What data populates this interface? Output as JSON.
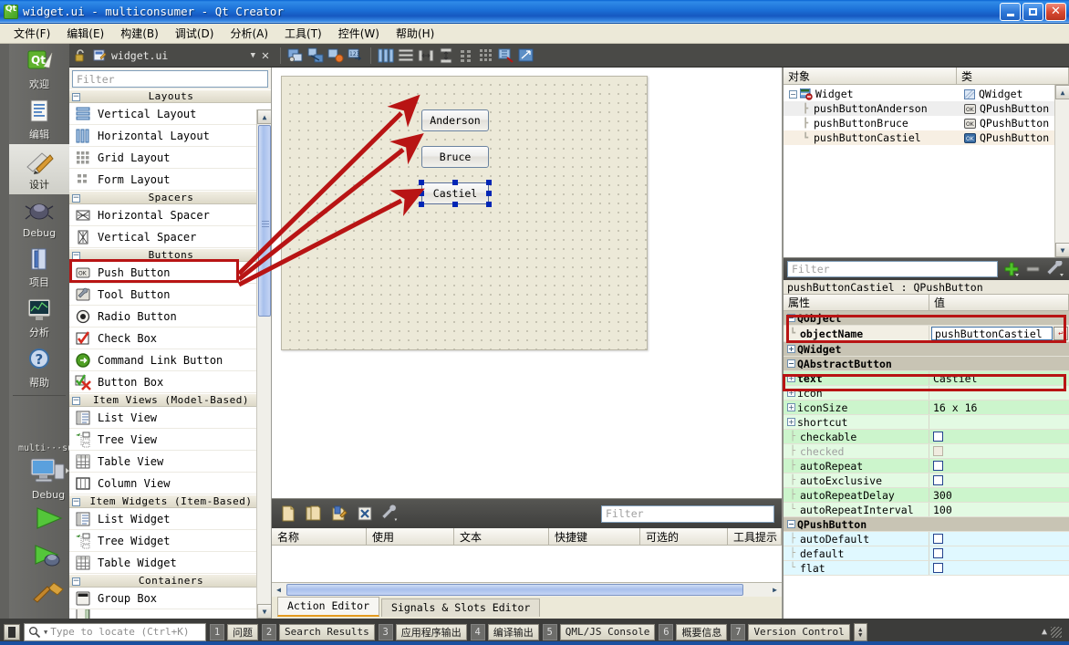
{
  "window": {
    "title": "widget.ui - multiconsumer - Qt Creator",
    "icon": "qt-logo-icon",
    "minimize": "minimize-button",
    "maximize": "maximize-button",
    "close": "close-button"
  },
  "menubar": {
    "items": [
      {
        "label": "文件(F)"
      },
      {
        "label": "编辑(E)"
      },
      {
        "label": "构建(B)"
      },
      {
        "label": "调试(D)"
      },
      {
        "label": "分析(A)"
      },
      {
        "label": "工具(T)"
      },
      {
        "label": "控件(W)"
      },
      {
        "label": "帮助(H)"
      }
    ]
  },
  "modebar": {
    "modes": [
      {
        "label": "欢迎",
        "icon": "qt-welcome-icon",
        "selected": false
      },
      {
        "label": "编辑",
        "icon": "edit-document-icon",
        "selected": false
      },
      {
        "label": "设计",
        "icon": "design-pencil-icon",
        "selected": true
      },
      {
        "label": "Debug",
        "icon": "bug-icon",
        "selected": false
      },
      {
        "label": "项目",
        "icon": "folder-projects-icon",
        "selected": false
      },
      {
        "label": "分析",
        "icon": "analyze-monitor-icon",
        "selected": false
      },
      {
        "label": "帮助",
        "icon": "help-question-icon",
        "selected": false
      }
    ],
    "project_name": "multi···sumer",
    "kit_label": "Debug",
    "kit_icon": "target-computer-icon",
    "run_buttons": [
      {
        "name": "run-button",
        "icon": "play-green-icon"
      },
      {
        "name": "debug-button",
        "icon": "play-debug-icon"
      },
      {
        "name": "build-button",
        "icon": "hammer-icon"
      }
    ]
  },
  "editor_toolbar": {
    "lock_icon": "unlock-icon",
    "file_icon": "ui-file-icon",
    "filename": "widget.ui",
    "dropdown_icon": "chevron-down-icon",
    "close_icon": "close-icon",
    "tools": [
      {
        "name": "edit-widgets-tool",
        "icon": "edit-widgets-icon"
      },
      {
        "name": "edit-signals-slots-tool",
        "icon": "signals-slots-icon"
      },
      {
        "name": "edit-buddies-tool",
        "icon": "buddies-icon"
      },
      {
        "name": "edit-tab-order-tool",
        "icon": "tab-order-icon"
      },
      {
        "name": "layout-horizontally-tool",
        "icon": "layout-horizontal-icon"
      },
      {
        "name": "layout-vertically-tool",
        "icon": "layout-vertical-icon"
      },
      {
        "name": "layout-splitter-horizontal-tool",
        "icon": "splitter-horizontal-icon"
      },
      {
        "name": "layout-splitter-vertical-tool",
        "icon": "splitter-vertical-icon"
      },
      {
        "name": "layout-form-tool",
        "icon": "layout-form-icon"
      },
      {
        "name": "layout-grid-tool",
        "icon": "layout-grid-icon"
      },
      {
        "name": "break-layout-tool",
        "icon": "break-layout-icon"
      },
      {
        "name": "adjust-size-tool",
        "icon": "adjust-size-icon"
      }
    ]
  },
  "widget_box": {
    "filter_placeholder": "Filter",
    "groups": [
      {
        "label": "Layouts",
        "expanded": true,
        "items": [
          {
            "label": "Vertical Layout",
            "icon": "vertical-layout-icon"
          },
          {
            "label": "Horizontal Layout",
            "icon": "horizontal-layout-icon"
          },
          {
            "label": "Grid Layout",
            "icon": "grid-layout-icon"
          },
          {
            "label": "Form Layout",
            "icon": "form-layout-icon"
          }
        ]
      },
      {
        "label": "Spacers",
        "expanded": true,
        "items": [
          {
            "label": "Horizontal Spacer",
            "icon": "horizontal-spacer-icon"
          },
          {
            "label": "Vertical Spacer",
            "icon": "vertical-spacer-icon"
          }
        ]
      },
      {
        "label": "Buttons",
        "expanded": true,
        "items": [
          {
            "label": "Push Button",
            "icon": "push-button-icon",
            "highlighted": true
          },
          {
            "label": "Tool Button",
            "icon": "tool-button-icon"
          },
          {
            "label": "Radio Button",
            "icon": "radio-button-icon"
          },
          {
            "label": "Check Box",
            "icon": "check-box-icon"
          },
          {
            "label": "Command Link Button",
            "icon": "command-link-icon"
          },
          {
            "label": "Button Box",
            "icon": "button-box-icon"
          }
        ]
      },
      {
        "label": "Item Views (Model-Based)",
        "expanded": true,
        "items": [
          {
            "label": "List View",
            "icon": "list-view-icon"
          },
          {
            "label": "Tree View",
            "icon": "tree-view-icon"
          },
          {
            "label": "Table View",
            "icon": "table-view-icon"
          },
          {
            "label": "Column View",
            "icon": "column-view-icon"
          }
        ]
      },
      {
        "label": "Item Widgets (Item-Based)",
        "expanded": true,
        "items": [
          {
            "label": "List Widget",
            "icon": "list-widget-icon"
          },
          {
            "label": "Tree Widget",
            "icon": "tree-widget-icon"
          },
          {
            "label": "Table Widget",
            "icon": "table-widget-icon"
          }
        ]
      },
      {
        "label": "Containers",
        "expanded": true,
        "items": [
          {
            "label": "Group Box",
            "icon": "group-box-icon"
          }
        ]
      }
    ]
  },
  "form_editor": {
    "buttons": [
      {
        "text": "Anderson",
        "selected": false
      },
      {
        "text": "Bruce",
        "selected": false
      },
      {
        "text": "Castiel",
        "selected": true
      }
    ]
  },
  "action_editor": {
    "toolbar": [
      {
        "name": "new-action-button",
        "icon": "new-file-icon"
      },
      {
        "name": "copy-action-button",
        "icon": "copy-icon"
      },
      {
        "name": "edit-action-button",
        "icon": "edit-action-icon"
      },
      {
        "name": "delete-action-button",
        "icon": "delete-x-icon"
      },
      {
        "name": "action-settings-button",
        "icon": "wrench-icon"
      }
    ],
    "filter_placeholder": "Filter",
    "columns": [
      "名称",
      "使用",
      "文本",
      "快捷键",
      "可选的",
      "工具提示"
    ],
    "rows": [],
    "tabs": [
      {
        "label": "Action Editor",
        "active": true
      },
      {
        "label": "Signals & Slots Editor",
        "active": false
      }
    ]
  },
  "object_inspector": {
    "columns": [
      "对象",
      "类"
    ],
    "rows": [
      {
        "name": "Widget",
        "class": "QWidget",
        "depth": 0,
        "icon": "widget-icon",
        "class_icon": "qwidget-icon",
        "selected": false
      },
      {
        "name": "pushButtonAnderson",
        "class": "QPushButton",
        "depth": 1,
        "icon": "",
        "class_icon": "push-button-icon",
        "selected": false
      },
      {
        "name": "pushButtonBruce",
        "class": "QPushButton",
        "depth": 1,
        "icon": "",
        "class_icon": "push-button-icon",
        "selected": false
      },
      {
        "name": "pushButtonCastiel",
        "class": "QPushButton",
        "depth": 1,
        "icon": "",
        "class_icon": "push-button-icon",
        "selected": true
      }
    ]
  },
  "property_editor": {
    "filter_placeholder": "Filter",
    "toolbar": [
      {
        "name": "add-dynamic-property-button",
        "icon": "plus-green-icon"
      },
      {
        "name": "remove-dynamic-property-button",
        "icon": "minus-gray-icon"
      },
      {
        "name": "property-settings-button",
        "icon": "wrench-icon"
      }
    ],
    "subject": "pushButtonCastiel : QPushButton",
    "columns": [
      "属性",
      "值"
    ],
    "rows": [
      {
        "name": "QObject",
        "value": "",
        "kind": "group",
        "expander": "minus",
        "highlighted": true
      },
      {
        "name": "objectName",
        "value": "pushButtonCastiel",
        "kind": "editing",
        "style": "lv0",
        "highlighted": true
      },
      {
        "name": "QWidget",
        "value": "",
        "kind": "group",
        "expander": "plus"
      },
      {
        "name": "QAbstractButton",
        "value": "",
        "kind": "group",
        "expander": "minus"
      },
      {
        "name": "text",
        "value": "Castiel",
        "kind": "value",
        "style": "green",
        "expander": "plus",
        "bold": true,
        "highlighted": true
      },
      {
        "name": "icon",
        "value": "",
        "kind": "value",
        "style": "green-light",
        "expander": "plus"
      },
      {
        "name": "iconSize",
        "value": "16 x 16",
        "kind": "value",
        "style": "green",
        "expander": "plus"
      },
      {
        "name": "shortcut",
        "value": "",
        "kind": "value",
        "style": "green-light",
        "expander": "plus"
      },
      {
        "name": "checkable",
        "value": "",
        "kind": "checkbox",
        "checked": false,
        "style": "green"
      },
      {
        "name": "checked",
        "value": "",
        "kind": "checkbox",
        "checked": false,
        "disabled": true,
        "style": "green-light"
      },
      {
        "name": "autoRepeat",
        "value": "",
        "kind": "checkbox",
        "checked": false,
        "style": "green"
      },
      {
        "name": "autoExclusive",
        "value": "",
        "kind": "checkbox",
        "checked": false,
        "style": "green-light"
      },
      {
        "name": "autoRepeatDelay",
        "value": "300",
        "kind": "value",
        "style": "green"
      },
      {
        "name": "autoRepeatInterval",
        "value": "100",
        "kind": "value",
        "style": "green-light"
      },
      {
        "name": "QPushButton",
        "value": "",
        "kind": "group",
        "expander": "minus"
      },
      {
        "name": "autoDefault",
        "value": "",
        "kind": "checkbox",
        "checked": false,
        "style": "cyan"
      },
      {
        "name": "default",
        "value": "",
        "kind": "checkbox",
        "checked": false,
        "style": "cyan"
      },
      {
        "name": "flat",
        "value": "",
        "kind": "checkbox",
        "checked": false,
        "style": "cyan"
      }
    ]
  },
  "statusbar": {
    "toggle_sidebar_icon": "toggle-sidebar-icon",
    "locator_icon": "search-icon",
    "locator_placeholder": "Type to locate (Ctrl+K)",
    "outputs": [
      {
        "num": "1",
        "label": "问题"
      },
      {
        "num": "2",
        "label": "Search Results"
      },
      {
        "num": "3",
        "label": "应用程序输出"
      },
      {
        "num": "4",
        "label": "编译输出"
      },
      {
        "num": "5",
        "label": "QML/JS Console"
      },
      {
        "num": "6",
        "label": "概要信息"
      },
      {
        "num": "7",
        "label": "Version Control"
      }
    ]
  },
  "annotations": {
    "arrow_color": "#b81414",
    "arrow_count": 3,
    "description": "three red arrows from Push Button widget to the three push buttons on the form"
  },
  "colors": {
    "titlebar": "#1b6fd6",
    "canvas": "#ece9d8",
    "highlight_red": "#b81414",
    "property_green": "#ccf5cc",
    "property_cyan": "#e0f8ff",
    "selection_blue": "#0026b5"
  }
}
